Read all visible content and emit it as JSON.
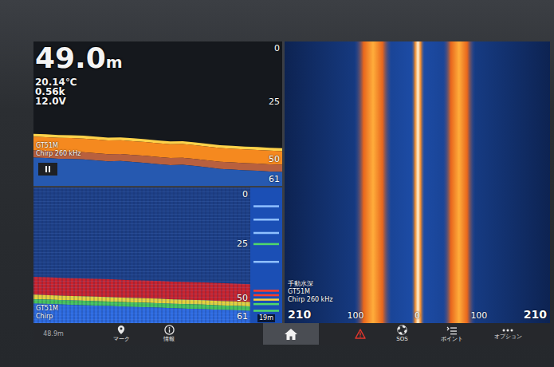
{
  "readouts": {
    "depth": "49.0",
    "depth_unit": "m",
    "temperature": "20.14℃",
    "speed": "0.56k",
    "voltage": "12.0V"
  },
  "sonar": {
    "source": "GT51M",
    "mode": "Chirp 260 kHz",
    "paused": true,
    "max_depth": 61,
    "scale": [
      "0",
      "25",
      "50",
      "61"
    ],
    "bottom_depths": [
      39,
      39.2,
      39.5,
      39.6,
      39.8,
      40.2,
      40.6,
      40.5,
      40.9,
      41.3,
      41.8,
      42.2,
      42.1,
      42.6,
      43.2,
      43.8,
      44.1,
      44.4,
      44.6,
      44.9,
      45.1
    ]
  },
  "downvu": {
    "source": "GT51M",
    "mode": "Chirp",
    "max_depth": 61,
    "scale": [
      "0",
      "25",
      "50",
      "61"
    ],
    "bottom_depths": [
      40.2,
      40.4,
      40.7,
      40.9,
      41.1,
      41.3,
      41.6,
      41.8,
      42,
      42.3,
      42.5,
      42.7,
      43,
      43.2,
      43.5
    ],
    "flasher_label": "19m",
    "flasher_returns": [
      {
        "depth": 8,
        "strength": 0.3
      },
      {
        "depth": 14,
        "strength": 0.35
      },
      {
        "depth": 20,
        "strength": 0.3
      },
      {
        "depth": 25,
        "strength": 0.5
      },
      {
        "depth": 33,
        "strength": 0.3
      },
      {
        "depth": 46,
        "strength": 0.9
      },
      {
        "depth": 48,
        "strength": 0.85
      },
      {
        "depth": 50,
        "strength": 0.7
      },
      {
        "depth": 52,
        "strength": 0.5
      },
      {
        "depth": 55,
        "strength": 0.45
      }
    ]
  },
  "sidevu": {
    "depth_mode": "手動水深",
    "source": "GT51M",
    "mode": "Chirp 260 kHz",
    "range_marks": [
      {
        "label": "210",
        "value": -210
      },
      {
        "label": "100",
        "value": -100
      },
      {
        "label": "0",
        "value": 0
      },
      {
        "label": "100",
        "value": 100
      },
      {
        "label": "210",
        "value": 210
      }
    ],
    "bands": [
      {
        "from": -100,
        "to": -40,
        "intensity": 0.8
      },
      {
        "from": -10,
        "to": 12,
        "intensity": 1
      },
      {
        "from": 40,
        "to": 92,
        "intensity": 0.8
      }
    ]
  },
  "toolbar": [
    {
      "kind": "readout",
      "label": "48.9m",
      "selected": false
    },
    {
      "kind": "mark",
      "label": "マーク",
      "selected": false
    },
    {
      "kind": "info",
      "label": "情報",
      "selected": false
    },
    {
      "kind": "home",
      "label": "",
      "selected": true
    },
    {
      "kind": "warning",
      "label": "",
      "selected": false
    },
    {
      "kind": "sos",
      "label": "SOS",
      "selected": false
    },
    {
      "kind": "points",
      "label": "ポイント",
      "selected": false
    },
    {
      "kind": "options",
      "label": "オプション",
      "selected": false
    }
  ]
}
